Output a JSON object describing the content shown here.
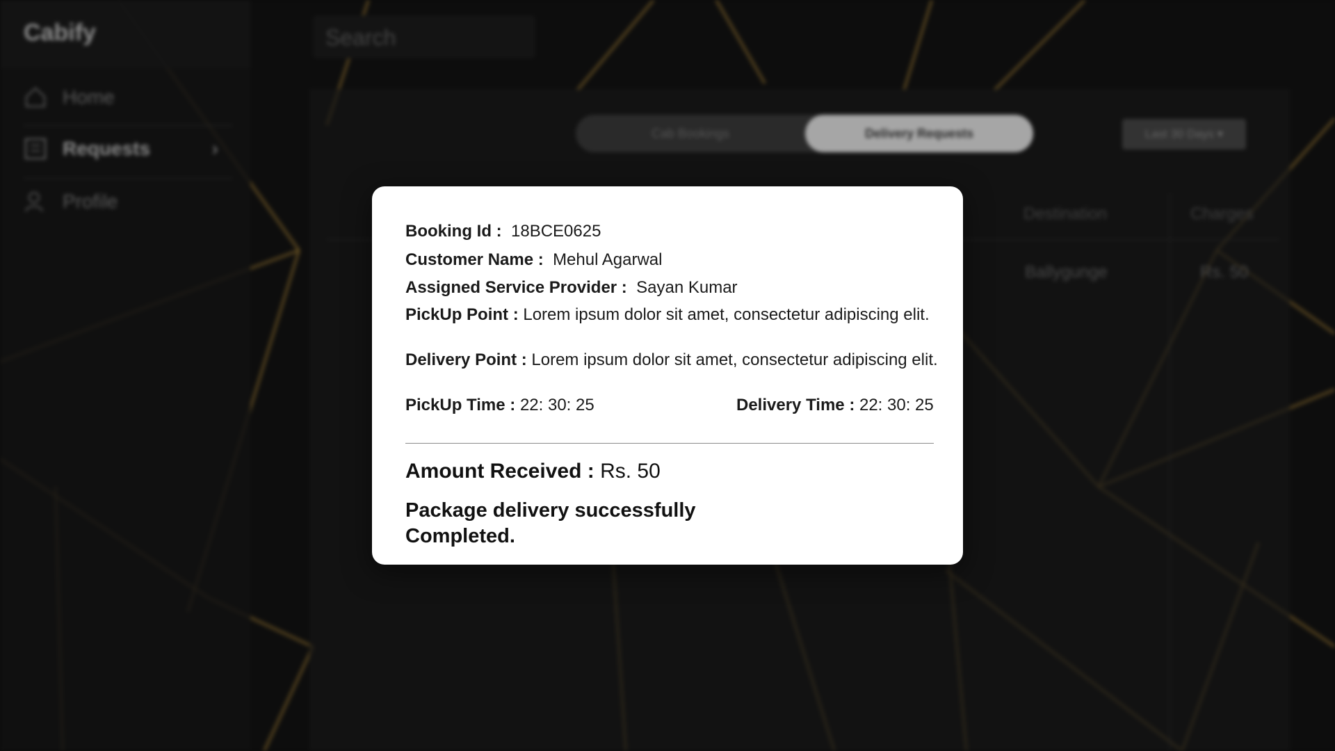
{
  "app": {
    "brand": "Cabify",
    "search_placeholder": "Search"
  },
  "sidebar": {
    "items": [
      {
        "label": "Home",
        "icon": "home-icon"
      },
      {
        "label": "Requests",
        "icon": "list-icon"
      },
      {
        "label": "Profile",
        "icon": "user-icon"
      }
    ],
    "chevron": "›"
  },
  "tabs": [
    {
      "label": "Cab Bookings"
    },
    {
      "label": "Delivery Requests"
    }
  ],
  "filter": {
    "label": "Last 30 Days ▾"
  },
  "table": {
    "columns": [
      "Destination",
      "Charges"
    ],
    "rows": [
      [
        "Ballygunge",
        "Rs. 50"
      ]
    ]
  },
  "modal": {
    "booking_id_label": "Booking Id :",
    "booking_id": "18BCE0625",
    "customer_label": "Customer Name :",
    "customer": "Mehul Agarwal",
    "provider_label": "Assigned Service Provider :",
    "provider": "Sayan Kumar",
    "pickup_point_label": "PickUp Point :",
    "pickup_point": "Lorem ipsum dolor sit amet, consectetur adipiscing elit.",
    "delivery_point_label": "Delivery Point :",
    "delivery_point": "Lorem ipsum dolor sit amet, consectetur adipiscing elit.",
    "pickup_time_label": "PickUp Time :",
    "pickup_time": "22: 30: 25",
    "delivery_time_label": "Delivery Time :",
    "delivery_time": "22: 30: 25",
    "amount_label": "Amount Received :",
    "amount": "Rs. 50",
    "status": "Package delivery successfully Completed."
  },
  "colors": {
    "background": "#0b0b0b",
    "pattern_line": "#8a6a2a",
    "modal_bg": "#ffffff"
  }
}
